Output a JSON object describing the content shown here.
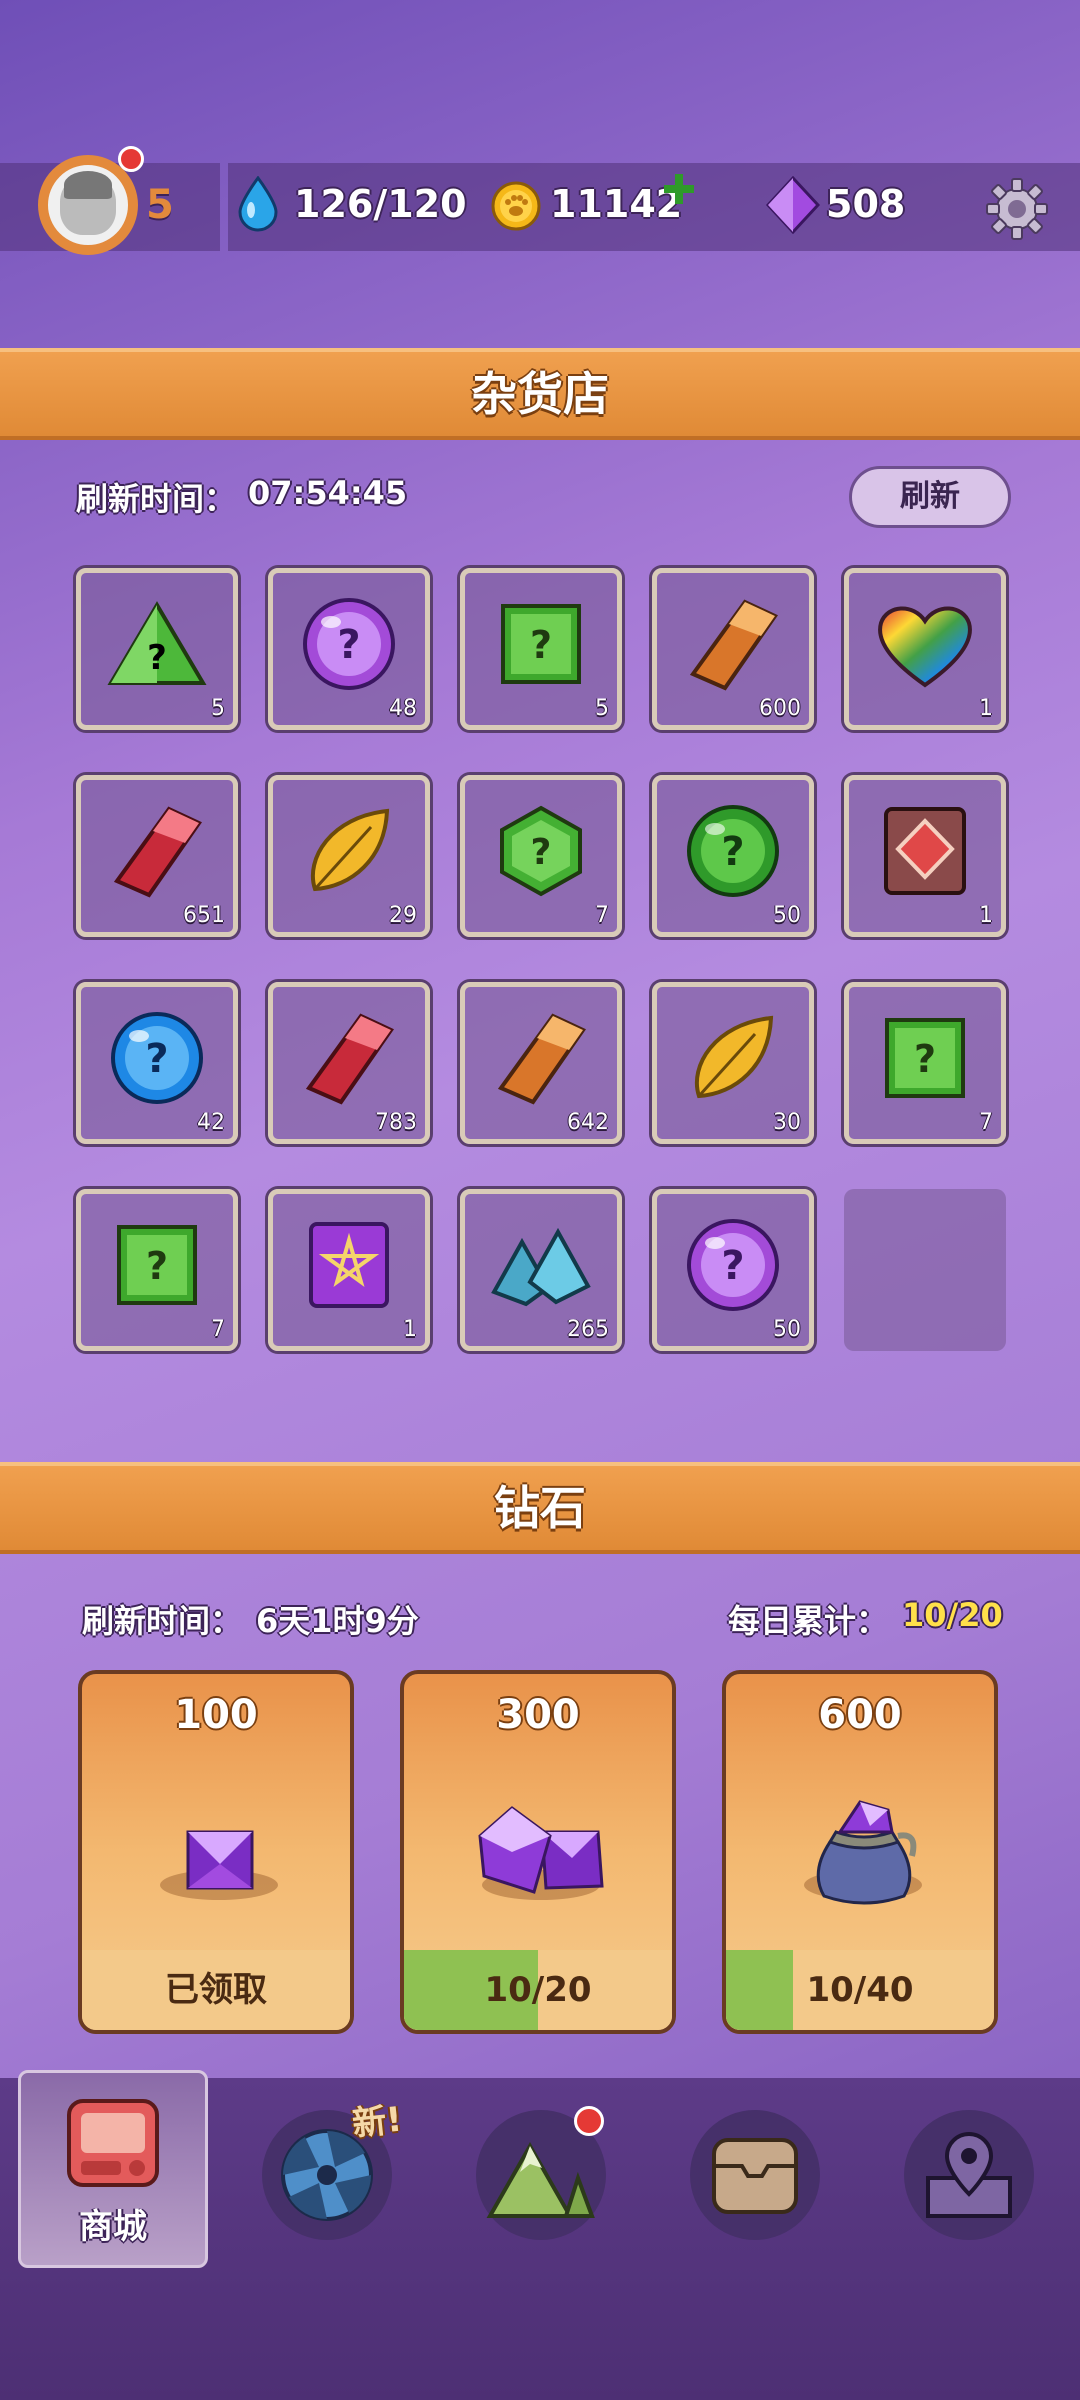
{
  "topbar": {
    "level": "5",
    "energy": "126/120",
    "coins": "11142",
    "gems": "508"
  },
  "grocery": {
    "title": "杂货店",
    "refresh_label": "刷新时间：",
    "refresh_time": "07:54:45",
    "refresh_button": "刷新",
    "items": [
      {
        "icon": "green-triangle-mystery-icon",
        "count": "5"
      },
      {
        "icon": "purple-orb-mystery-icon",
        "count": "48"
      },
      {
        "icon": "green-square-mystery-icon",
        "count": "5"
      },
      {
        "icon": "orange-crystal-icon",
        "count": "600"
      },
      {
        "icon": "rainbow-heart-icon",
        "count": "1"
      },
      {
        "icon": "red-crystal-icon",
        "count": "651"
      },
      {
        "icon": "golden-leaf-icon",
        "count": "29"
      },
      {
        "icon": "green-hexagon-mystery-icon",
        "count": "7"
      },
      {
        "icon": "green-orb-mystery-icon",
        "count": "50"
      },
      {
        "icon": "rune-book-icon",
        "count": "1"
      },
      {
        "icon": "blue-orb-mystery-icon",
        "count": "42"
      },
      {
        "icon": "red-crystal-icon",
        "count": "783"
      },
      {
        "icon": "orange-crystal-icon",
        "count": "642"
      },
      {
        "icon": "golden-leaf-icon",
        "count": "30"
      },
      {
        "icon": "green-square-mystery-icon",
        "count": "7"
      },
      {
        "icon": "green-square-mystery-icon",
        "count": "7"
      },
      {
        "icon": "purple-star-card-icon",
        "count": "1"
      },
      {
        "icon": "blue-stones-icon",
        "count": "265"
      },
      {
        "icon": "purple-orb-mystery-icon",
        "count": "50"
      }
    ]
  },
  "diamond": {
    "title": "钻石",
    "refresh_label": "刷新时间：",
    "refresh_time": "6天1时9分",
    "daily_label": "每日累计：",
    "daily_value": "10/20",
    "cards": [
      {
        "amount": "100",
        "footer": "已领取",
        "progress": 0
      },
      {
        "amount": "300",
        "footer": "10/20",
        "progress": 0.5
      },
      {
        "amount": "600",
        "footer": "10/40",
        "progress": 0.25
      }
    ]
  },
  "nav": {
    "shop_label": "商城",
    "new_badge": "新!"
  },
  "colors": {
    "accent_orange": "#e08a36",
    "progress_green": "#8fc152"
  }
}
